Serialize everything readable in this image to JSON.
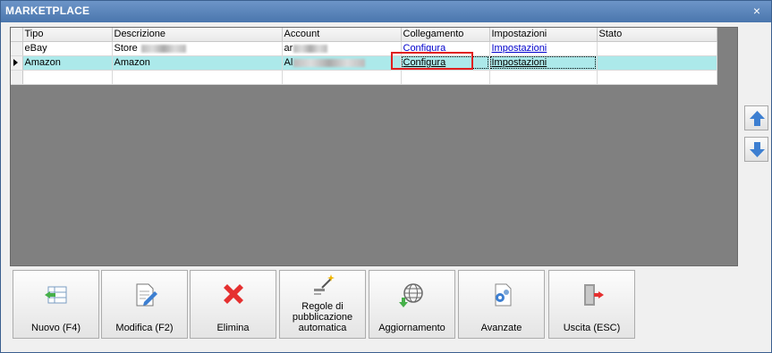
{
  "window": {
    "title": "MARKETPLACE",
    "close_glyph": "×"
  },
  "grid": {
    "columns": [
      "Tipo",
      "Descrizione",
      "Account",
      "Collegamento",
      "Impostazioni",
      "Stato"
    ],
    "rows": [
      {
        "tipo": "eBay",
        "descrizione": "Store",
        "account": "ar",
        "collegamento": "Configura",
        "impostazioni": "Impostazioni",
        "stato": ""
      },
      {
        "tipo": "Amazon",
        "descrizione": "Amazon",
        "account": "Al",
        "collegamento": "Configura",
        "impostazioni": "Impostazioni",
        "stato": ""
      },
      {
        "tipo": "",
        "descrizione": "",
        "account": "",
        "collegamento": "",
        "impostazioni": "",
        "stato": ""
      }
    ]
  },
  "side_buttons": {
    "up_icon": "arrow-up-icon",
    "down_icon": "arrow-down-icon",
    "color": "#3d7fd1"
  },
  "toolbar": {
    "nuovo": "Nuovo (F4)",
    "modifica": "Modifica (F2)",
    "elimina": "Elimina",
    "regole": "Regole di pubblicazione automatica",
    "aggiornamento": "Aggiornamento",
    "avanzate": "Avanzate",
    "uscita": "Uscita (ESC)"
  },
  "colors": {
    "selected_row": "#ace9ea",
    "highlight_box": "#e02020",
    "titlebar": "#5a83b4",
    "delete_red": "#e53030"
  }
}
